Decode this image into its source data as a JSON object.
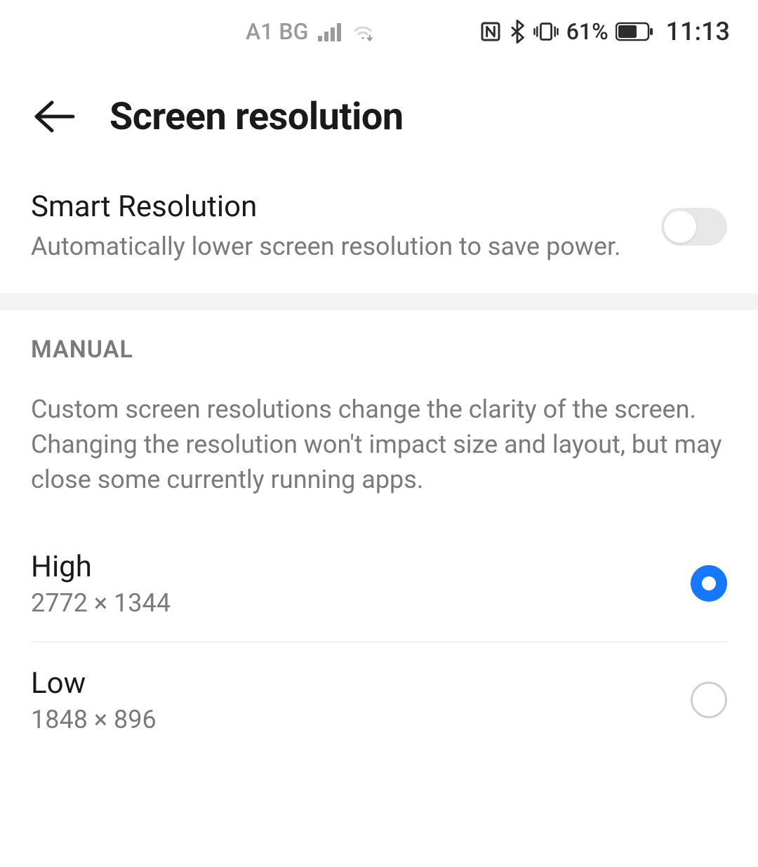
{
  "statusbar": {
    "carrier": "A1 BG",
    "battery_text": "61%",
    "time": "11:13"
  },
  "header": {
    "title": "Screen resolution"
  },
  "smart": {
    "title": "Smart Resolution",
    "description": "Automatically lower screen resolution to save power.",
    "enabled": false
  },
  "manual": {
    "section_label": "MANUAL",
    "description": "Custom screen resolutions change the clarity of the screen. Changing the resolution won't impact size and layout, but may close some currently running apps.",
    "options": [
      {
        "label": "High",
        "value": "2772 × 1344",
        "selected": true
      },
      {
        "label": "Low",
        "value": "1848 × 896",
        "selected": false
      }
    ]
  }
}
